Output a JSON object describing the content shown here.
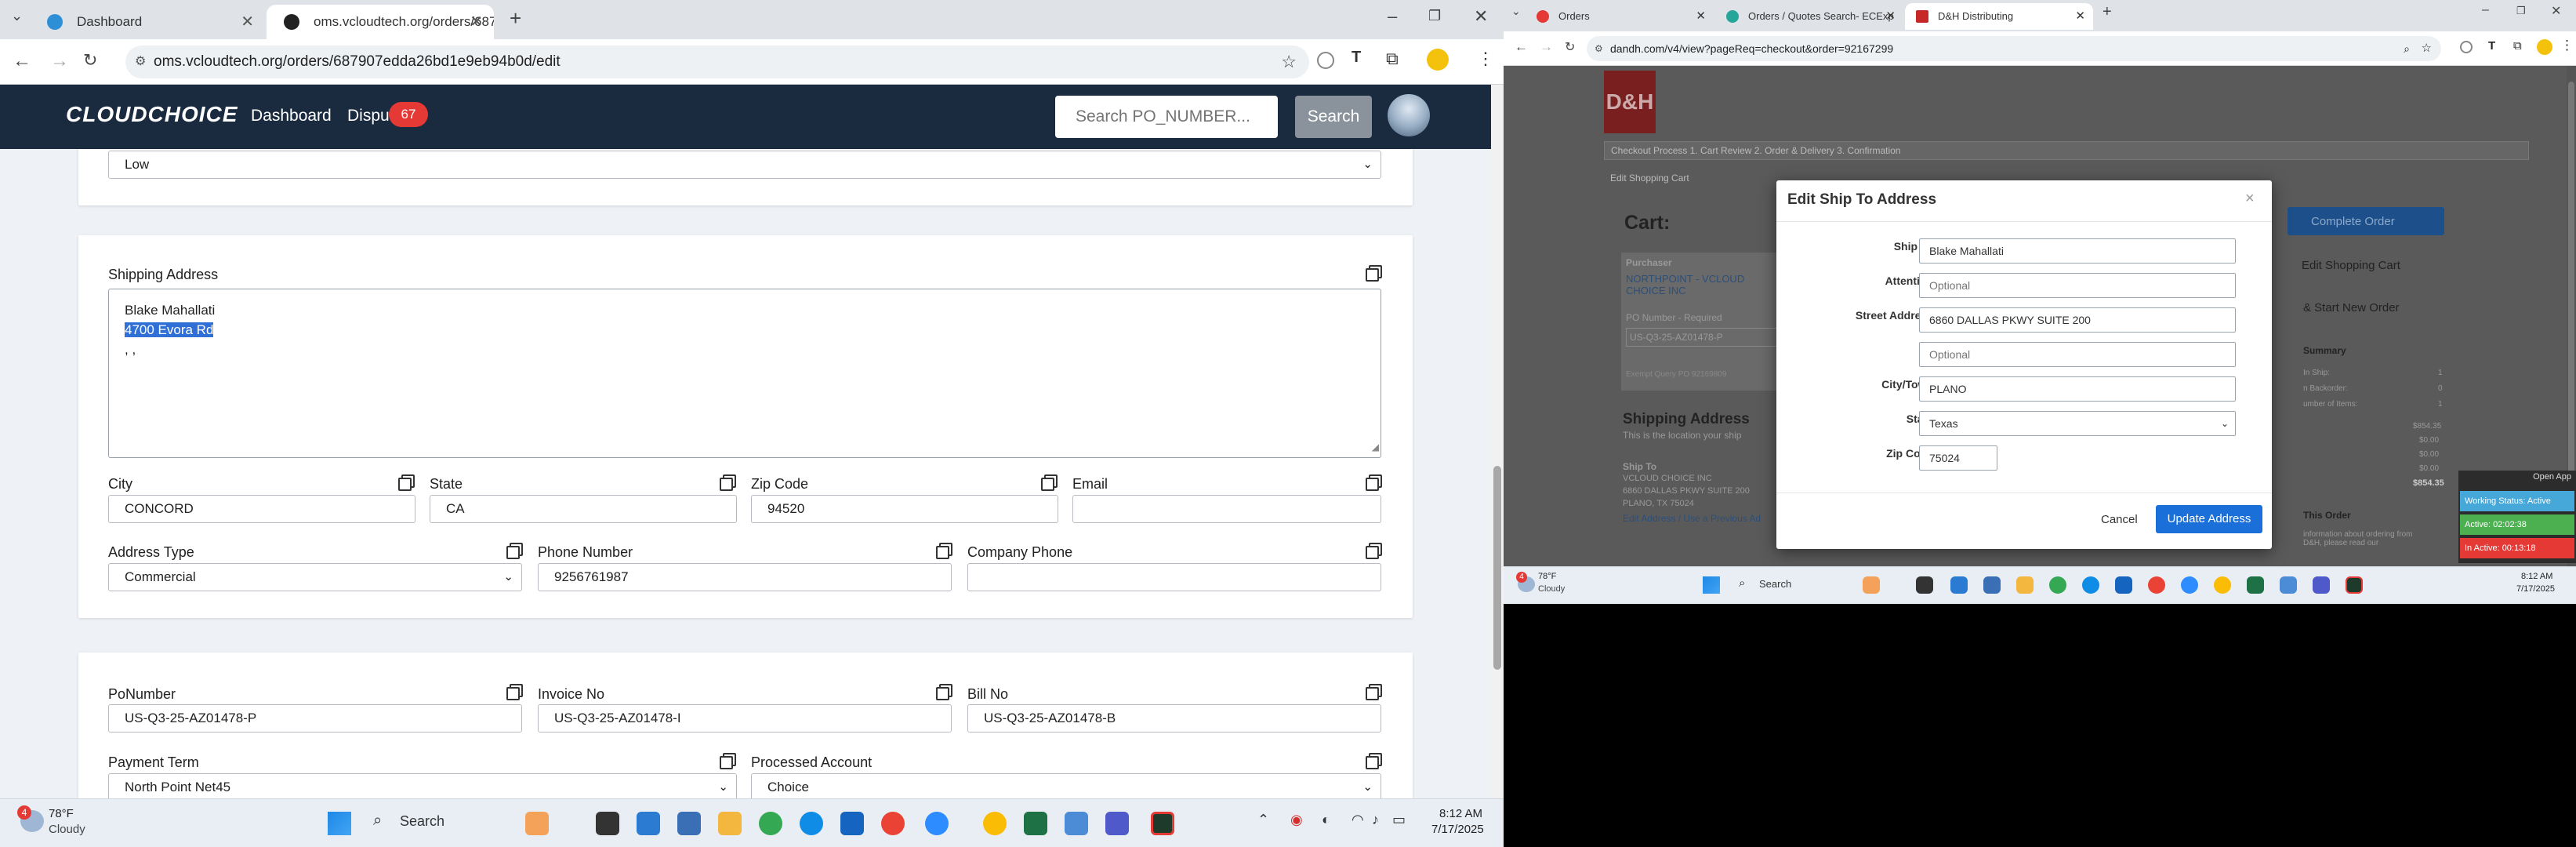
{
  "left_browser": {
    "tabs": [
      {
        "title": "Dashboard"
      },
      {
        "title": "oms.vcloudtech.org/orders/687"
      }
    ],
    "url": "oms.vcloudtech.org/orders/687907edda26bd1e9eb94b0d/edit",
    "app": {
      "logo": "CLOUDCHOICE",
      "nav_dashboard": "Dashboard",
      "nav_disputes": "Dispu",
      "disputes_badge": "67",
      "search_placeholder": "Search PO_NUMBER...",
      "search_button": "Search"
    },
    "priority_value": "Low",
    "shipping": {
      "label": "Shipping Address",
      "line1": "Blake Mahallati",
      "line2": "4700 Evora Rd",
      "line3": ", ,",
      "city_label": "City",
      "city": "CONCORD",
      "state_label": "State",
      "state": "CA",
      "zip_label": "Zip Code",
      "zip": "94520",
      "email_label": "Email",
      "email": "",
      "addrtype_label": "Address Type",
      "addrtype": "Commercial",
      "phone_label": "Phone Number",
      "phone": "9256761987",
      "company_phone_label": "Company Phone",
      "company_phone": ""
    },
    "order": {
      "po_label": "PoNumber",
      "po": "US-Q3-25-AZ01478-P",
      "invoice_label": "Invoice No",
      "invoice": "US-Q3-25-AZ01478-I",
      "bill_label": "Bill No",
      "bill": "US-Q3-25-AZ01478-B",
      "payterm_label": "Payment Term",
      "payterm": "North Point Net45",
      "processed_label": "Processed Account",
      "processed": "Choice"
    },
    "taskbar": {
      "weather_temp": "78°F",
      "weather_desc": "Cloudy",
      "weather_badge": "4",
      "search": "Search",
      "time": "8:12 AM",
      "date": "7/17/2025"
    }
  },
  "right_browser": {
    "tabs": [
      {
        "title": "Orders"
      },
      {
        "title": "Orders / Quotes Search- ECExp"
      },
      {
        "title": "D&H Distributing"
      }
    ],
    "url": "dandh.com/v4/view?pageReq=checkout&order=92167299",
    "page": {
      "logo": "D&H",
      "steps": "Checkout Process  1. Cart Review  2. Order & Delivery  3. Confirmation",
      "edit_cart_link": "Edit Shopping Cart",
      "cart_title": "Cart:",
      "complete_order": "Complete Order",
      "edit_shopping_cart": "Edit Shopping Cart",
      "save_start": "& Start New Order",
      "summary": "Summary",
      "purchaser_label": "Purchaser",
      "purchaser": "NORTHPOINT - VCLOUD CHOICE INC",
      "po_required": "PO Number - Required",
      "po_value": "US-Q3-25-AZ01478-P",
      "exempt": "Exempt Query PO 92169809",
      "shipping_title": "Shipping Address",
      "shipping_sub": "This is the location your ship",
      "ship_to_label": "Ship To",
      "ship_lines": [
        "VCLOUD CHOICE INC",
        "6860 DALLAS PKWY SUITE 200",
        "PLANO, TX 75024"
      ],
      "edit_address": "Edit Address / Use a Previous Ad",
      "summary_rows": [
        [
          "In Ship:",
          "1"
        ],
        [
          "n Backorder:",
          "0"
        ],
        [
          "umber of Items:",
          "1"
        ]
      ],
      "amounts": [
        "$854.35",
        "$0.00",
        "$0.00",
        "$0.00",
        "$854.35"
      ],
      "this_order": "This Order",
      "note": "information about ordering from D&H, please read our"
    },
    "modal": {
      "title": "Edit Ship To Address",
      "ship_to_label": "Ship To",
      "ship_to": "Blake Mahallati",
      "attention_label": "Attention",
      "attention_placeholder": "Optional",
      "street_label": "Street Address",
      "street": "6860 DALLAS PKWY SUITE 200",
      "street2_placeholder": "Optional",
      "city_label": "City/Town",
      "city": "PLANO",
      "state_label": "State",
      "state": "Texas",
      "zip_label": "Zip Code",
      "zip": "75024",
      "cancel": "Cancel",
      "update": "Update Address"
    },
    "widget": {
      "open": "Open App",
      "status": "Working Status: Active",
      "active": "Active: 02:02:38",
      "inactive": "In Active: 00:13:18"
    },
    "taskbar": {
      "weather_temp": "78°F",
      "weather_desc": "Cloudy",
      "weather_badge": "4",
      "search": "Search",
      "time": "8:12 AM",
      "date": "7/17/2025"
    }
  },
  "colors": {
    "navy": "#1a2b3f",
    "selection": "#2f6fd6",
    "badge": "#e53935",
    "dh_red": "#b71c1c",
    "primary_btn": "#1a6fd9"
  }
}
